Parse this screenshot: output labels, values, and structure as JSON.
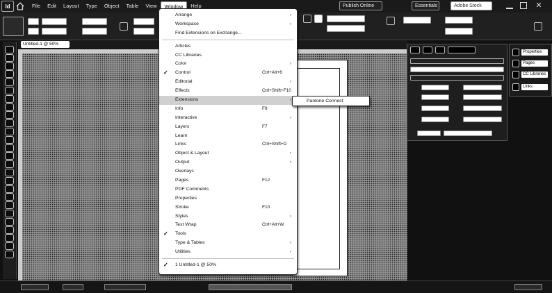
{
  "menubar": {
    "app_logo": "Id",
    "items": [
      {
        "label": "File"
      },
      {
        "label": "Edit"
      },
      {
        "label": "Layout"
      },
      {
        "label": "Type"
      },
      {
        "label": "Object"
      },
      {
        "label": "Table"
      },
      {
        "label": "View"
      },
      {
        "label": "Window",
        "active": true
      },
      {
        "label": "Help"
      }
    ],
    "workspace": "Publish Online",
    "essentials": "Essentials",
    "search_placeholder": "Adobe Stock"
  },
  "document_tab": {
    "label": "Untitled-1 @ 50%"
  },
  "window_menu": {
    "items": [
      {
        "label": "Arrange",
        "submenu": true
      },
      {
        "label": "Workspace",
        "submenu": true
      },
      {
        "label": "Find Extensions on Exchange..."
      },
      {
        "separator": true
      },
      {
        "label": "Articles"
      },
      {
        "label": "CC Libraries"
      },
      {
        "label": "Color",
        "submenu": true
      },
      {
        "label": "Control",
        "checked": true,
        "shortcut": "Ctrl+Alt+6"
      },
      {
        "label": "Editorial",
        "submenu": true
      },
      {
        "label": "Effects",
        "shortcut": "Ctrl+Shift+F10"
      },
      {
        "label": "Extensions",
        "submenu": true,
        "highlighted": true
      },
      {
        "label": "Info",
        "shortcut": "F8"
      },
      {
        "label": "Interactive",
        "submenu": true
      },
      {
        "label": "Layers",
        "shortcut": "F7"
      },
      {
        "label": "Learn"
      },
      {
        "label": "Links",
        "shortcut": "Ctrl+Shift+D"
      },
      {
        "label": "Object & Layout",
        "submenu": true
      },
      {
        "label": "Output",
        "submenu": true
      },
      {
        "label": "Overlays"
      },
      {
        "label": "Pages",
        "shortcut": "F12"
      },
      {
        "label": "PDF Comments"
      },
      {
        "label": "Properties"
      },
      {
        "label": "Stroke",
        "shortcut": "F10"
      },
      {
        "label": "Styles",
        "submenu": true
      },
      {
        "label": "Text Wrap",
        "shortcut": "Ctrl+Alt+W"
      },
      {
        "label": "Tools",
        "checked": true
      },
      {
        "label": "Type & Tables",
        "submenu": true
      },
      {
        "label": "Utilities",
        "submenu": true
      },
      {
        "separator": true
      },
      {
        "label": "1 Untitled-1 @ 50%",
        "checked": true
      }
    ],
    "extensions_submenu": [
      {
        "label": "Pantone Connect"
      }
    ]
  },
  "right_panel": {
    "side_items": [
      {
        "icon": "properties-icon",
        "label": "Properties"
      },
      {
        "icon": "pages-icon",
        "label": "Pages"
      },
      {
        "icon": "cc-libraries-icon",
        "label": "CC Libraries"
      },
      {
        "icon": "links-icon",
        "label": "Links"
      }
    ]
  },
  "colors": {
    "ui_background": "#1a1a1a",
    "menu_background": "#ffffff",
    "highlight": "#d0d0d0",
    "pasteboard": "#7a7a7a"
  }
}
